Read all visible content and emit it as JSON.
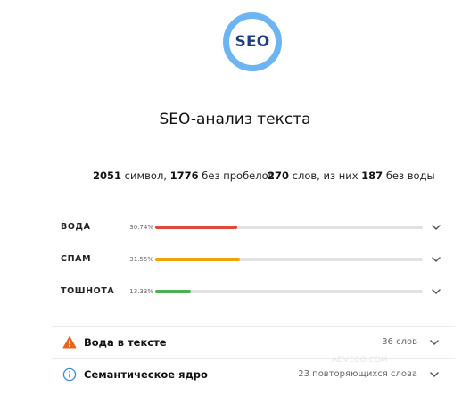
{
  "logo": {
    "text": "SEO"
  },
  "title": "SEO-анализ текста",
  "stats": {
    "chars": "2051",
    "chars_label": " символ, ",
    "chars_nospace": "1776",
    "chars_nospace_label": " без пробелов",
    "words": "270",
    "words_label": " слов, из них ",
    "words_nowater": "187",
    "words_nowater_label": " без воды"
  },
  "metrics": [
    {
      "label": "ВОДА",
      "value": "30.74%",
      "percent": 30.74,
      "color": "#e0493a"
    },
    {
      "label": "СПАМ",
      "value": "31.55%",
      "percent": 31.55,
      "color": "#f0a20a"
    },
    {
      "label": "ТОШНОТА",
      "value": "13.33%",
      "percent": 13.33,
      "color": "#4caf50"
    }
  ],
  "panels": [
    {
      "title": "Вода в тексте",
      "meta": "36 слов",
      "icon": "warning-icon",
      "icon_color": "#e8641b"
    },
    {
      "title": "Семантическое ядро",
      "meta": "23 повторяющихся слова",
      "icon": "info-icon",
      "icon_color": "#3a8fd6"
    }
  ],
  "watermark": "ADVEGO.COM"
}
